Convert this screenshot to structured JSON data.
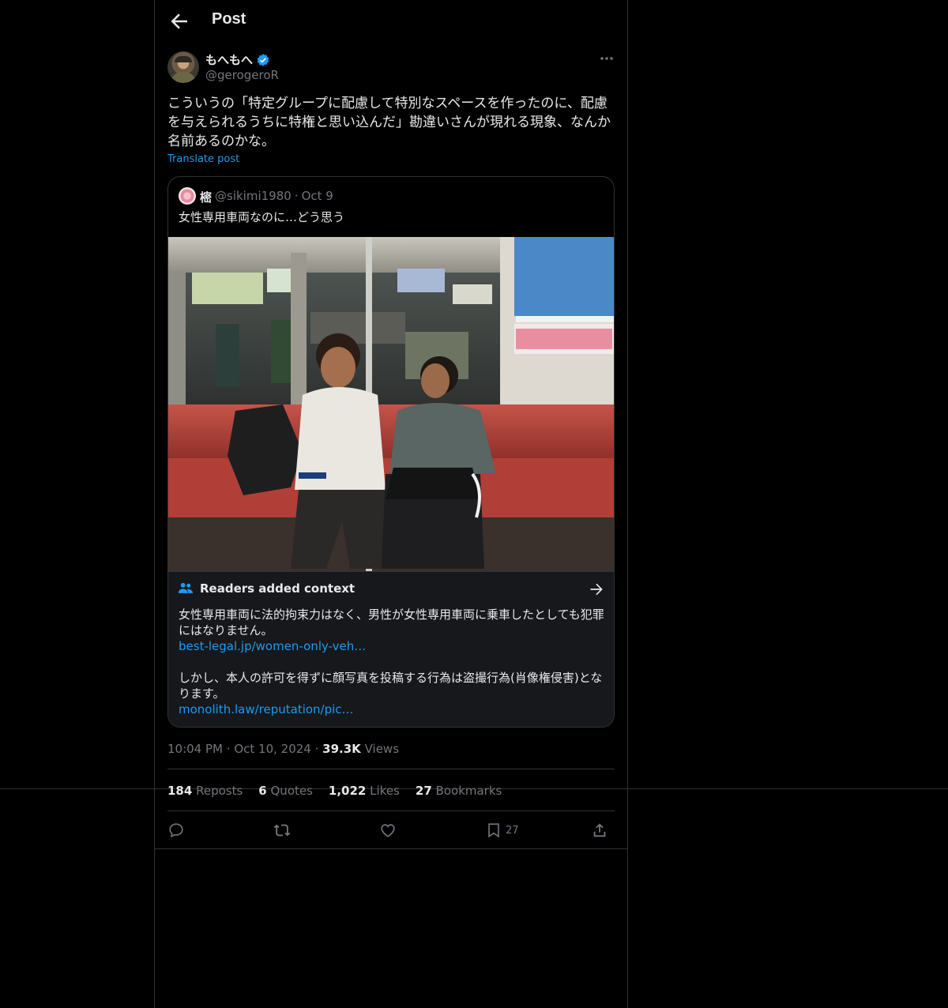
{
  "header": {
    "title": "Post"
  },
  "author": {
    "display_name": "もへもへ",
    "handle": "@gerogeroR"
  },
  "post": {
    "text": "こういうの「特定グループに配慮して特別なスペースを作ったのに、配慮を与えられるうちに特権と思い込んだ」勘違いさんが現れる現象、なんか名前あるのかな。",
    "translate_label": "Translate post"
  },
  "quote": {
    "name": "樒",
    "handle": "@sikimi1980",
    "dot": "·",
    "date": "Oct 9",
    "text": "女性専用車両なのに…どう思う"
  },
  "context": {
    "heading": "Readers added context",
    "p1": "女性専用車両に法的拘束力はなく、男性が女性専用車両に乗車したとしても犯罪にはなりません。",
    "link1": "best-legal.jp/women-only-veh…",
    "p2": "しかし、本人の許可を得ずに顔写真を投稿する行為は盗撮行為(肖像権侵害)となります。",
    "link2": "monolith.law/reputation/pic…"
  },
  "meta": {
    "time": "10:04 PM",
    "date": "Oct 10, 2024",
    "dot": "·",
    "views_count": "39.3K",
    "views_label": "Views"
  },
  "stats": {
    "reposts_count": "184",
    "reposts_label": "Reposts",
    "quotes_count": "6",
    "quotes_label": "Quotes",
    "likes_count": "1,022",
    "likes_label": "Likes",
    "bookmarks_count": "27",
    "bookmarks_label": "Bookmarks"
  },
  "actions": {
    "bookmark_count": "27"
  },
  "colors": {
    "background": "#000000",
    "accent": "#1d9bf0",
    "muted": "#71767b",
    "border": "#2f3336",
    "seat_red": "#b9453d"
  }
}
